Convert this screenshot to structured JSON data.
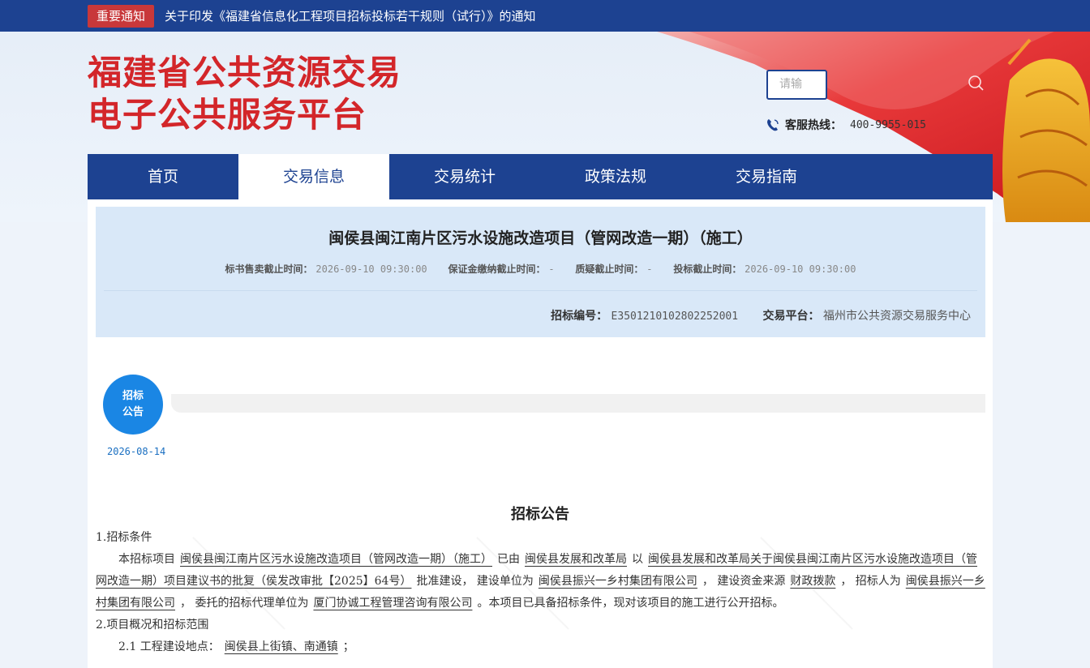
{
  "notice": {
    "tag": "重要通知",
    "text": "关于印发《福建省信息化工程项目招标投标若干规则（试行）》的通知"
  },
  "header": {
    "logo_line1": "福建省公共资源交易",
    "logo_line2": "电子公共服务平台",
    "search_placeholder": "请输",
    "hotline_label": "客服热线：",
    "hotline_number": "400-9955-015"
  },
  "nav": {
    "items": [
      "首页",
      "交易信息",
      "交易统计",
      "政策法规",
      "交易指南"
    ],
    "active_index": 1
  },
  "project": {
    "title": "闽侯县闽江南片区污水设施改造项目（管网改造一期）（施工）",
    "sale_deadline_label": "标书售卖截止时间：",
    "sale_deadline": "2026-09-10 09:30:00",
    "deposit_deadline_label": "保证金缴纳截止时间：",
    "deposit_deadline": "-",
    "query_deadline_label": "质疑截止时间：",
    "query_deadline": "-",
    "bid_deadline_label": "投标截止时间：",
    "bid_deadline": "2026-09-10 09:30:00",
    "code_label": "招标编号：",
    "code": "E3501210102802252001",
    "platform_label": "交易平台：",
    "platform": "福州市公共资源交易服务中心"
  },
  "timeline": {
    "stage_line1": "招标",
    "stage_line2": "公告",
    "date": "2026-08-14"
  },
  "document": {
    "title": "招标公告",
    "section1": "1.招标条件",
    "p1_a": "本招标项目",
    "p1_project": "闽侯县闽江南片区污水设施改造项目（管网改造一期）（施工）",
    "p1_b": "已由",
    "p1_approver": "闽侯县发展和改革局",
    "p1_c": "以",
    "p1_approval": "闽侯县发展和改革局关于闽侯县闽江南片区污水设施改造项目（管网改造一期）项目建议书的批复（侯发改审批【2025】64号）",
    "p1_d": "批准建设，  建设单位为",
    "p1_owner": "闽侯县振兴一乡村集团有限公司",
    "p1_e": "，  建设资金来源",
    "p1_fund": "财政拨款",
    "p1_f": "，  招标人为",
    "p1_tenderer": "闽侯县振兴一乡村集团有限公司",
    "p1_g": "，  委托的招标代理单位为",
    "p1_agent": "厦门协诚工程管理咨询有限公司",
    "p1_h": "。本项目已具备招标条件，现对该项目的施工进行公开招标。",
    "section2": "2.项目概况和招标范围",
    "s21_label": "2.1  工程建设地点：",
    "s21_value": "闽侯县上街镇、南通镇",
    "s21_end": "；"
  },
  "colors": {
    "primary_blue": "#1d4291",
    "logo_red": "#d3262a",
    "notice_tag_red": "#c8383a",
    "timeline_blue": "#1a86e4",
    "info_bg": "#d9e8f8"
  }
}
